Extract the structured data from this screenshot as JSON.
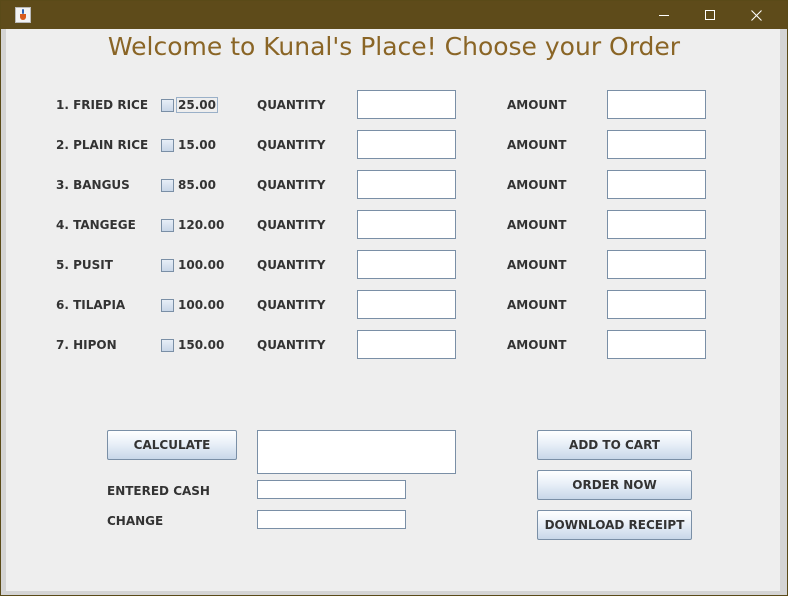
{
  "window": {
    "title": ""
  },
  "heading": "Welcome to Kunal's Place! Choose your Order",
  "menu_items": [
    {
      "name": "1. FRIED RICE",
      "price": "25.00",
      "qty_label": "QUANTITY",
      "amt_label": "AMOUNT",
      "quantity": "",
      "amount": "",
      "checked": false
    },
    {
      "name": "2. PLAIN RICE",
      "price": "15.00",
      "qty_label": "QUANTITY",
      "amt_label": "AMOUNT",
      "quantity": "",
      "amount": "",
      "checked": false
    },
    {
      "name": "3. BANGUS",
      "price": "85.00",
      "qty_label": "QUANTITY",
      "amt_label": "AMOUNT",
      "quantity": "",
      "amount": "",
      "checked": false
    },
    {
      "name": "4. TANGEGE",
      "price": "120.00",
      "qty_label": "QUANTITY",
      "amt_label": "AMOUNT",
      "quantity": "",
      "amount": "",
      "checked": false
    },
    {
      "name": "5. PUSIT",
      "price": "100.00",
      "qty_label": "QUANTITY",
      "amt_label": "AMOUNT",
      "quantity": "",
      "amount": "",
      "checked": false
    },
    {
      "name": "6. TILAPIA",
      "price": "100.00",
      "qty_label": "QUANTITY",
      "amt_label": "AMOUNT",
      "quantity": "",
      "amount": "",
      "checked": false
    },
    {
      "name": "7. HIPON",
      "price": "150.00",
      "qty_label": "QUANTITY",
      "amt_label": "AMOUNT",
      "quantity": "",
      "amount": "",
      "checked": false
    }
  ],
  "buttons": {
    "calculate": "CALCULATE",
    "add_to_cart": "ADD TO CART",
    "order_now": "ORDER NOW",
    "download_receipt": "DOWNLOAD RECEIPT"
  },
  "total": {
    "value": ""
  },
  "cash": {
    "label": "ENTERED CASH",
    "value": ""
  },
  "change": {
    "label": "CHANGE",
    "value": ""
  },
  "icons": {
    "app": "java-cup-icon",
    "minimize": "minimize-icon",
    "maximize": "maximize-icon",
    "close": "close-icon"
  },
  "colors": {
    "titlebar": "#5e4b1a",
    "heading": "#8a6526",
    "background": "#eeeeee",
    "border": "#7a8fa6"
  }
}
